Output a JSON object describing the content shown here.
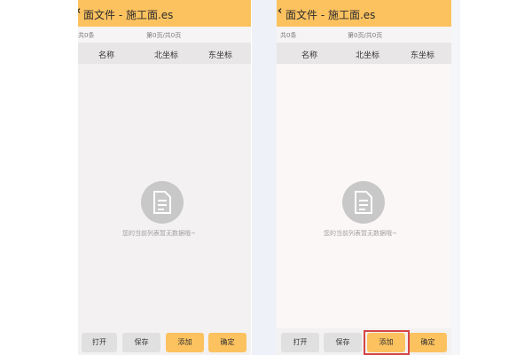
{
  "colors": {
    "accent": "#fcc25f",
    "highlight": "#d64545"
  },
  "icons": {
    "back": "chevron-left-icon",
    "empty": "document-icon"
  },
  "left": {
    "header": {
      "back_glyph": "‹",
      "title": "面文件 - 施工面.es"
    },
    "info": {
      "count": "共0条",
      "page": "第0页/共0页"
    },
    "columns": [
      "名称",
      "北坐标",
      "东坐标"
    ],
    "empty_text": "您的当前列表暂无数据哦~",
    "buttons": {
      "open": "打开",
      "save": "保存",
      "add": "添加",
      "confirm": "确定"
    }
  },
  "right": {
    "header": {
      "back_glyph": "‹",
      "title": "面文件 - 施工面.es"
    },
    "info": {
      "count": "共0条",
      "page": "第0页/共0页"
    },
    "columns": [
      "名称",
      "北坐标",
      "东坐标"
    ],
    "empty_text": "您的当前列表暂无数据哦~",
    "buttons": {
      "open": "打开",
      "save": "保存",
      "add": "添加",
      "confirm": "确定"
    }
  }
}
